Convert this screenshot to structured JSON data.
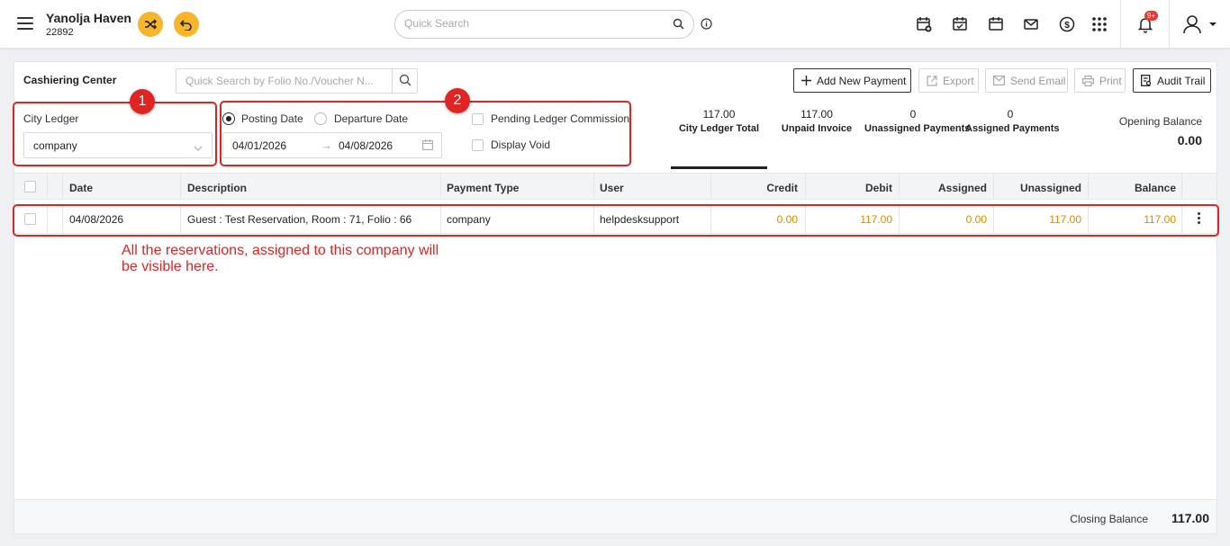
{
  "header": {
    "hotel_name": "Yanolja Haven",
    "hotel_id": "22892",
    "search_placeholder": "Quick Search",
    "notification_badge": "9+",
    "accent_color": "#f7b52c"
  },
  "page": {
    "title": "Cashiering Center",
    "folio_search_placeholder": "Quick Search by Folio No./Voucher N...",
    "buttons": {
      "add_payment": "Add New Payment",
      "export": "Export",
      "send_email": "Send Email",
      "print": "Print",
      "audit_trail": "Audit Trail"
    }
  },
  "filters": {
    "city_ledger_label": "City Ledger",
    "city_ledger_value": "company",
    "posting_date_label": "Posting Date",
    "departure_date_label": "Departure Date",
    "selected_date_type": "Posting Date",
    "date_from": "04/01/2026",
    "date_to": "04/08/2026",
    "pending_ledger_commission_label": "Pending Ledger Commission",
    "display_void_label": "Display Void"
  },
  "summary": {
    "city_ledger_total": "117.00",
    "city_ledger_total_label": "City Ledger Total",
    "unpaid_invoice": "117.00",
    "unpaid_invoice_label": "Unpaid Invoice",
    "unassigned_payments": "0",
    "unassigned_payments_label": "Unassigned Payments",
    "assigned_payments": "0",
    "assigned_payments_label": "Assigned Payments",
    "opening_balance_label": "Opening Balance",
    "opening_balance": "0.00"
  },
  "table": {
    "columns": [
      "Date",
      "Description",
      "Payment Type",
      "User",
      "Credit",
      "Debit",
      "Assigned",
      "Unassigned",
      "Balance"
    ],
    "rows": [
      {
        "date": "04/08/2026",
        "description": "Guest : Test Reservation, Room : 71, Folio : 66",
        "payment_type": "company",
        "user": "helpdesksupport",
        "credit": "0.00",
        "debit": "117.00",
        "assigned": "0.00",
        "unassigned": "117.00",
        "balance": "117.00"
      }
    ]
  },
  "footer": {
    "closing_balance_label": "Closing Balance",
    "closing_balance": "117.00"
  },
  "annotations": {
    "marker_1": "1",
    "marker_2": "2",
    "note": "All the reservations, assigned to this company will be visible here.",
    "color": "#e02424"
  }
}
